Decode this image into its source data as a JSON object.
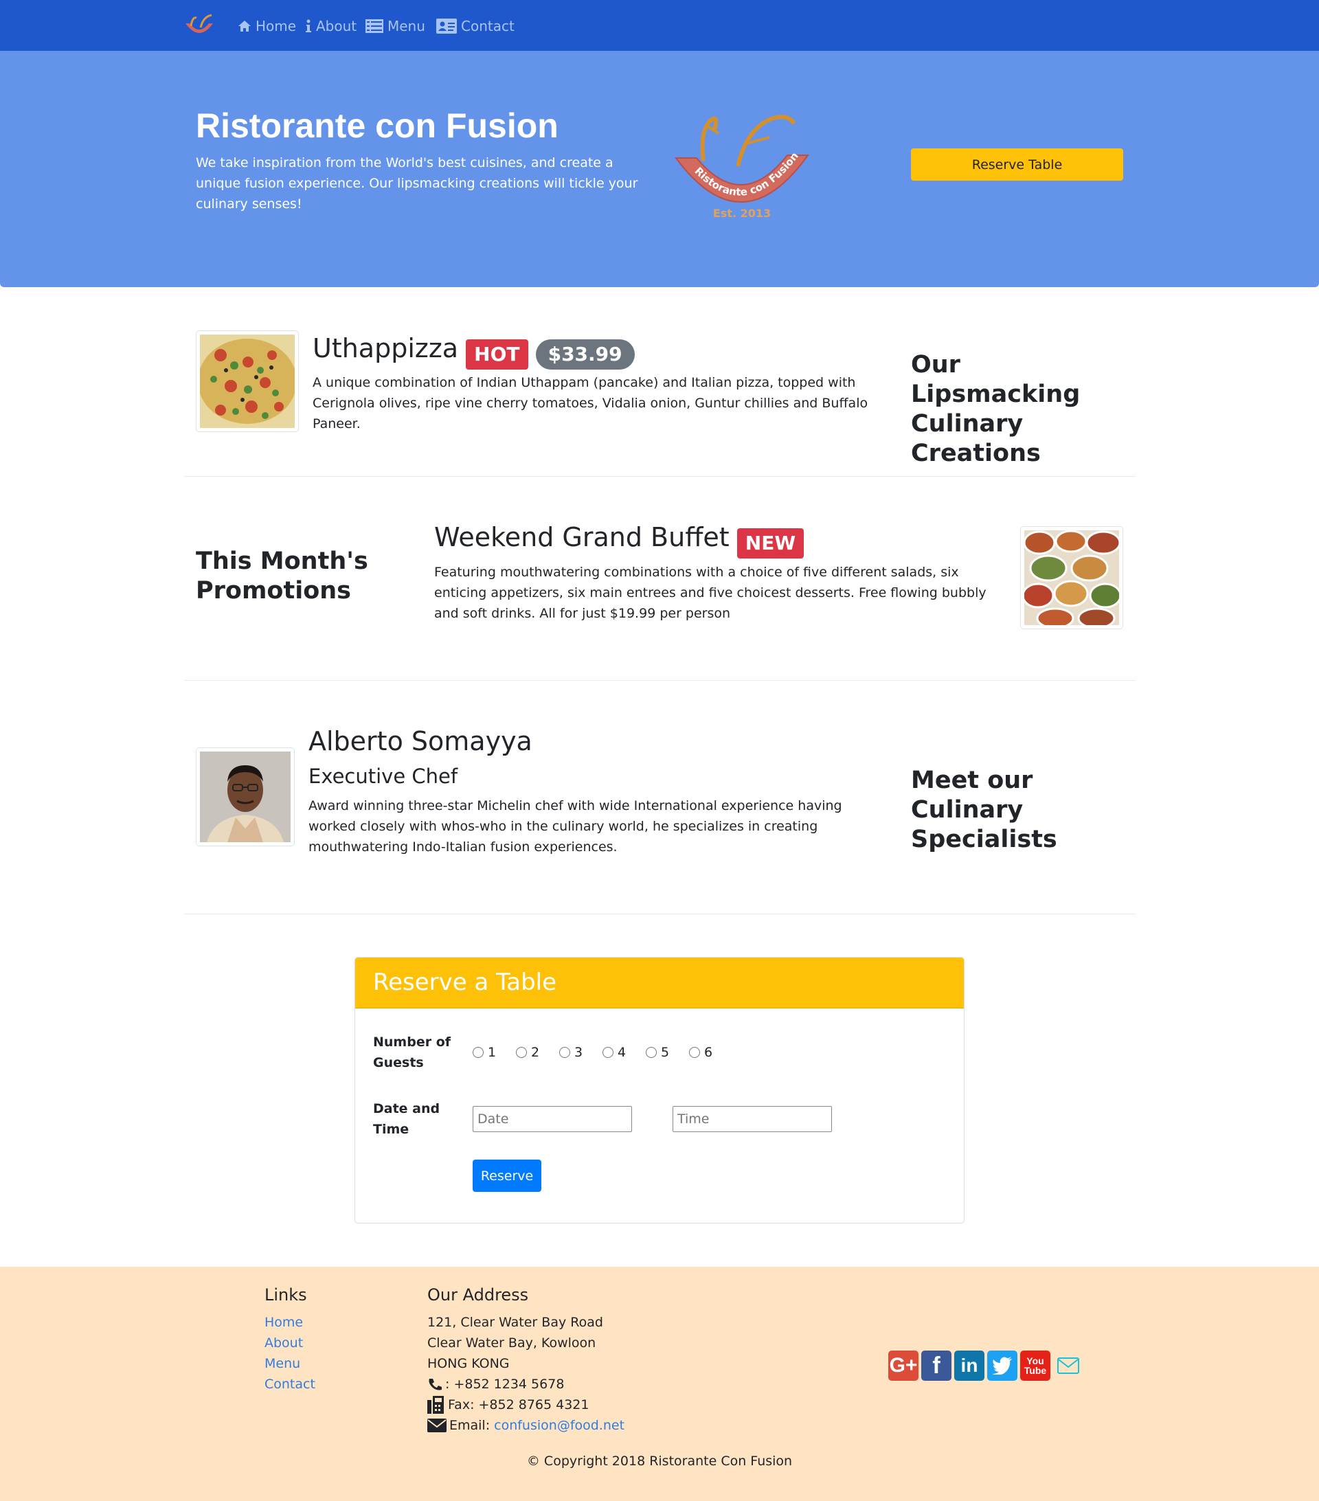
{
  "nav": {
    "logo_alt": "Ristorante con Fusion logo",
    "items": [
      {
        "label": "Home",
        "icon": "home-icon"
      },
      {
        "label": "About",
        "icon": "info-icon"
      },
      {
        "label": "Menu",
        "icon": "list-icon"
      },
      {
        "label": "Contact",
        "icon": "address-card-icon"
      }
    ]
  },
  "hero": {
    "title": "Ristorante con Fusion",
    "description": "We take inspiration from the World's best cuisines, and create a unique fusion experience. Our lipsmacking creations will tickle your culinary senses!",
    "logo_text": "Ristorante con Fusion",
    "logo_est": "Est. 2013",
    "reserve_button": "Reserve Table"
  },
  "dish": {
    "name": "Uthappizza",
    "badge": "HOT",
    "price": "$33.99",
    "description": "A unique combination of Indian Uthappam (pancake) and Italian pizza, topped with Cerignola olives, ripe vine cherry tomatoes, Vidalia onion, Guntur chillies and Buffalo Paneer.",
    "side_title": "Our Lipsmacking Culinary Creations"
  },
  "promotion": {
    "side_title": "This Month's Promotions",
    "name": "Weekend Grand Buffet",
    "badge": "NEW",
    "description": "Featuring mouthwatering combinations with a choice of five different salads, six enticing appetizers, six main entrees and five choicest desserts. Free flowing bubbly and soft drinks. All for just $19.99 per person"
  },
  "leader": {
    "name": "Alberto Somayya",
    "designation": "Executive Chef",
    "description": "Award winning three-star Michelin chef with wide International experience having worked closely with whos-who in the culinary world, he specializes in creating mouthwatering Indo-Italian fusion experiences.",
    "side_title": "Meet our Culinary Specialists"
  },
  "reservation": {
    "title": "Reserve a Table",
    "guests_label": "Number of Guests",
    "guest_options": [
      "1",
      "2",
      "3",
      "4",
      "5",
      "6"
    ],
    "datetime_label": "Date and Time",
    "date_placeholder": "Date",
    "time_placeholder": "Time",
    "submit": "Reserve"
  },
  "footer": {
    "links_title": "Links",
    "links": [
      "Home",
      "About",
      "Menu",
      "Contact"
    ],
    "address_title": "Our Address",
    "address_lines": [
      "121, Clear Water Bay Road",
      "Clear Water Bay, Kowloon",
      "HONG KONG"
    ],
    "phone": ": +852 1234 5678",
    "fax": "Fax: +852 8765 4321",
    "email_label": "Email:",
    "email": "confusion@food.net",
    "social_icons": [
      "google-plus-icon",
      "facebook-icon",
      "linkedin-icon",
      "twitter-icon",
      "youtube-icon",
      "envelope-icon"
    ],
    "copyright": "© Copyright 2018 Ristorante Con Fusion"
  },
  "colors": {
    "navbar": "#1f57cc",
    "jumbotron": "#6494ea",
    "warning": "#ffc107",
    "danger": "#dc3545",
    "primary": "#007bff",
    "footer": "#ffe4c3"
  }
}
